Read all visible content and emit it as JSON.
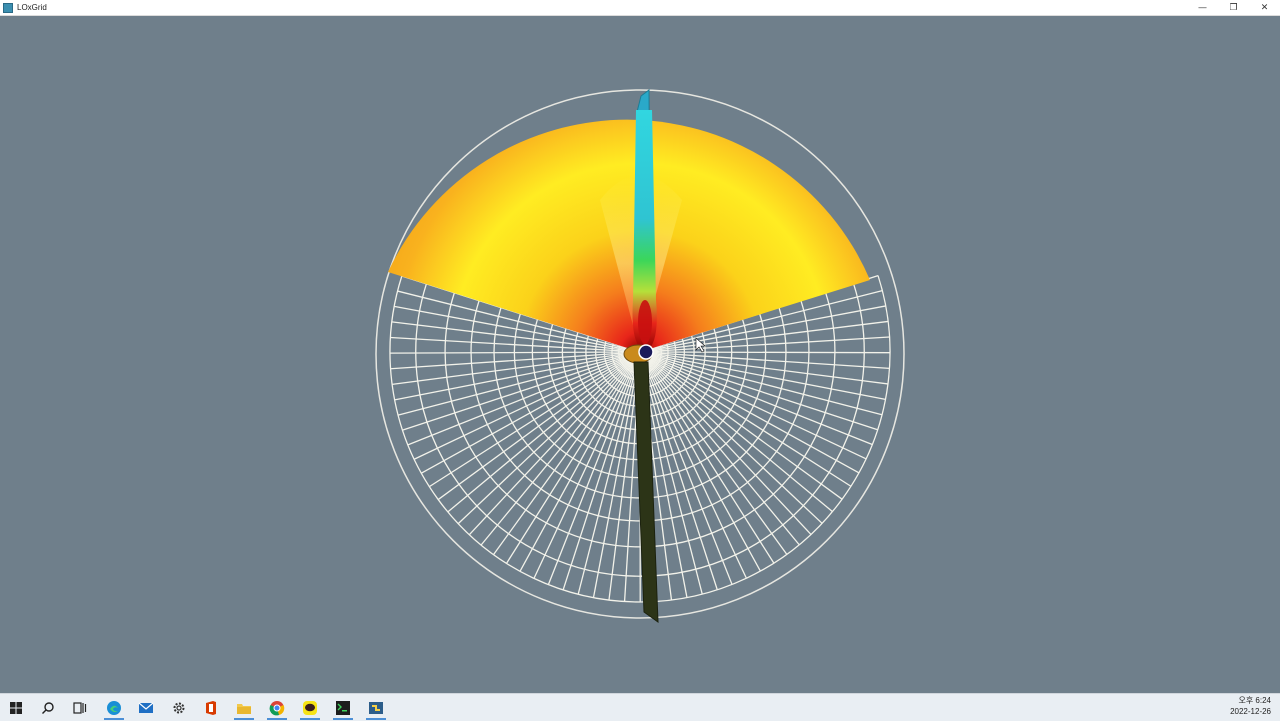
{
  "window": {
    "title": "LOxGrid",
    "controls": {
      "minimize": "—",
      "restore": "❐",
      "close": "✕"
    }
  },
  "scene": {
    "background_color": "#6f7f8b",
    "grid_color": "#f2f2ea",
    "colormap": [
      "#8b0000",
      "#e8251a",
      "#f7a318",
      "#ffe21a",
      "#ffff3a",
      "#3bd65a",
      "#31d6e0"
    ]
  },
  "taskbar": {
    "items": [
      "start-icon",
      "search-icon",
      "task-view-icon",
      "edge-icon",
      "mail-icon",
      "settings-icon",
      "office-icon",
      "file-explorer-icon",
      "chrome-icon",
      "kakaotalk-icon",
      "terminal-icon",
      "python-icon"
    ],
    "clock": {
      "period_time": "오후 6:24",
      "date": "2022-12-26"
    }
  }
}
